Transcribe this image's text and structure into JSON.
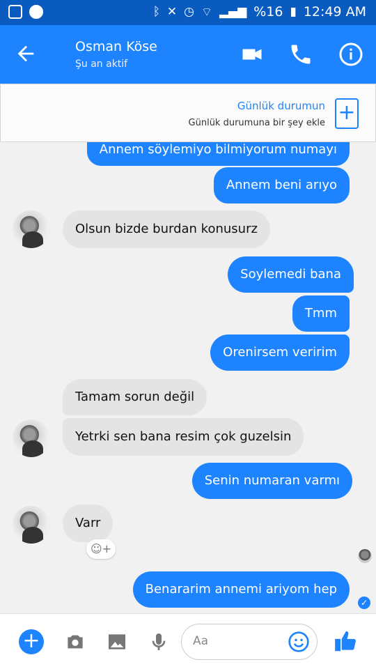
{
  "statusbar": {
    "battery": "%16",
    "time": "12:49 AM"
  },
  "header": {
    "contact_name": "Osman Köse",
    "contact_status": "Şu an aktif"
  },
  "day_story": {
    "title": "Günlük durumun",
    "subtitle": "Günlük durumuna bir şey ekle"
  },
  "messages": [
    {
      "from": "me",
      "text": "Annem söylemiyo bilmiyorum numayı"
    },
    {
      "from": "me",
      "text": "Annem beni arıyo"
    },
    {
      "from": "them",
      "text": "Olsun bizde burdan konusurz"
    },
    {
      "from": "me",
      "text": "Soylemedi bana"
    },
    {
      "from": "me",
      "text": "Tmm"
    },
    {
      "from": "me",
      "text": "Orenirsem veririm"
    },
    {
      "from": "them",
      "text": "Tamam sorun değil"
    },
    {
      "from": "them",
      "text": "Yetrki sen bana resim çok guzelsin"
    },
    {
      "from": "me",
      "text": "Senin numaran varmı"
    },
    {
      "from": "them",
      "text": "Varr"
    },
    {
      "from": "me",
      "text": "Benararim annemi ariyom hep"
    }
  ],
  "composer": {
    "placeholder": "Aa"
  },
  "colors": {
    "brand": "#1d83ff",
    "statusbar": "#0a5bbf",
    "incoming_bubble": "#e4e4e4"
  }
}
